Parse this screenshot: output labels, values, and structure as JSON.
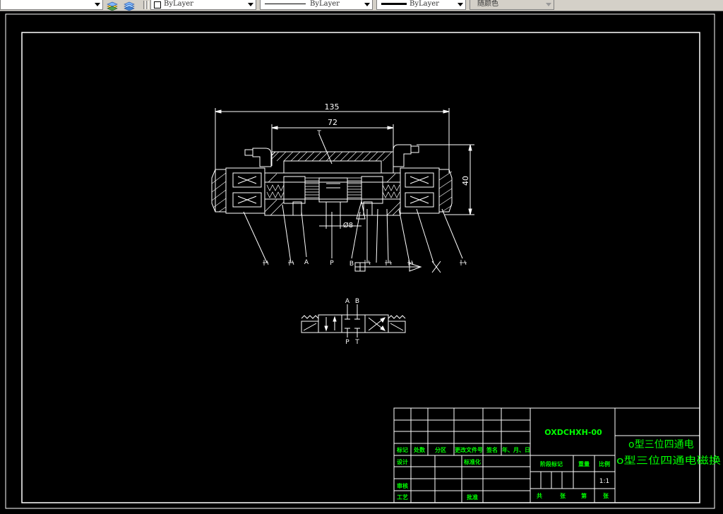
{
  "toolbar": {
    "layer_color_value": "ByLayer",
    "linetype_value": "ByLayer",
    "lineweight_value": "ByLayer",
    "plotstyle_value": "随颜色"
  },
  "drawing": {
    "dim_overall": "135",
    "dim_inner": "72",
    "dim_height": "40",
    "dim_diameter": "Ø8",
    "port_label_t": "T",
    "port_label_a": "A",
    "port_label_p": "P",
    "port_label_b": "B",
    "symbol_label_a": "A",
    "symbol_label_b": "B",
    "symbol_label_p": "P",
    "symbol_label_t": "T"
  },
  "title_block": {
    "drawing_number": "OXDCHXH-00",
    "title_line_1": "o型三位四通电",
    "title_line_2": "o型三位四通电磁换",
    "scale": "1:1",
    "hdr_mark": "标记",
    "hdr_count": "处数",
    "hdr_zone": "分区",
    "hdr_doc": "更改文件号",
    "hdr_sign": "签名",
    "hdr_date": "年、月、日",
    "row_design": "设计",
    "row_standard": "标准化",
    "row_review": "审核",
    "row_process": "工艺",
    "row_approve": "批准",
    "stage_label": "阶段标记",
    "weight_label": "重量",
    "scale_label": "比例",
    "sheets_total_1": "共",
    "sheets_total_2": "张",
    "sheet_no_1": "第",
    "sheet_no_2": "张"
  },
  "colors": {
    "canvas": "#000000",
    "lines": "#ffffff",
    "title_text": "#00ff00",
    "toolbar": "#d4d0c8"
  }
}
